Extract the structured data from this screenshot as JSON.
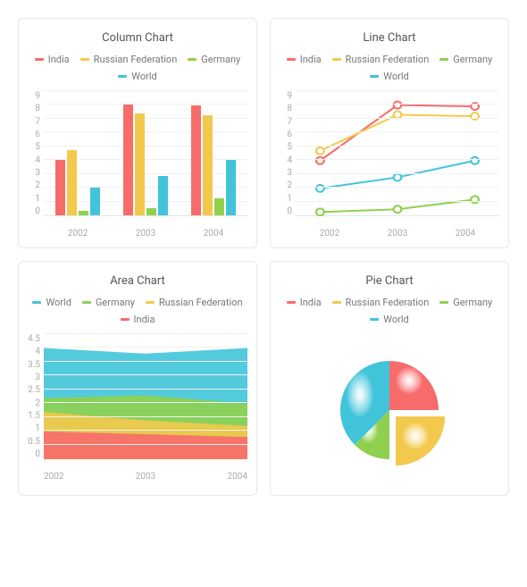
{
  "colors": {
    "India": "#f86b6b",
    "Russian Federation": "#f2c94c",
    "Germany": "#8fd14f",
    "World": "#41c4d9"
  },
  "chart_data": [
    {
      "id": "column",
      "type": "bar",
      "title": "Column Chart",
      "categories": [
        "2002",
        "2003",
        "2004"
      ],
      "series": [
        {
          "name": "India",
          "values": [
            4.0,
            8.0,
            7.9
          ]
        },
        {
          "name": "Russian Federation",
          "values": [
            4.7,
            7.3,
            7.2
          ]
        },
        {
          "name": "Germany",
          "values": [
            0.3,
            0.5,
            1.2
          ]
        },
        {
          "name": "World",
          "values": [
            2.0,
            2.8,
            4.0
          ]
        }
      ],
      "ylim": [
        0,
        9
      ],
      "yticks": [
        0,
        1,
        2,
        3,
        4,
        5,
        6,
        7,
        8,
        9
      ]
    },
    {
      "id": "line",
      "type": "line",
      "title": "Line Chart",
      "categories": [
        "2002",
        "2003",
        "2004"
      ],
      "series": [
        {
          "name": "India",
          "values": [
            4.0,
            8.0,
            7.9
          ]
        },
        {
          "name": "Russian Federation",
          "values": [
            4.7,
            7.3,
            7.2
          ]
        },
        {
          "name": "Germany",
          "values": [
            0.3,
            0.5,
            1.2
          ]
        },
        {
          "name": "World",
          "values": [
            2.0,
            2.8,
            4.0
          ]
        }
      ],
      "ylim": [
        0,
        9
      ],
      "yticks": [
        0,
        1,
        2,
        3,
        4,
        5,
        6,
        7,
        8,
        9
      ]
    },
    {
      "id": "area",
      "type": "area",
      "title": "Area Chart",
      "categories": [
        "2002",
        "2003",
        "2004"
      ],
      "series_order": [
        "World",
        "Germany",
        "Russian Federation",
        "India"
      ],
      "series": [
        {
          "name": "World",
          "values": [
            4.0,
            3.8,
            4.0
          ]
        },
        {
          "name": "Germany",
          "values": [
            2.2,
            2.3,
            2.0
          ]
        },
        {
          "name": "Russian Federation",
          "values": [
            1.7,
            1.4,
            1.2
          ]
        },
        {
          "name": "India",
          "values": [
            1.0,
            0.9,
            0.8
          ]
        }
      ],
      "ylim": [
        0,
        4.5
      ],
      "yticks": [
        0,
        0.5,
        1,
        1.5,
        2,
        2.5,
        3,
        3.5,
        4,
        4.5
      ]
    },
    {
      "id": "pie",
      "type": "pie",
      "title": "Pie Chart",
      "series": [
        {
          "name": "India",
          "value": 25
        },
        {
          "name": "Russian Federation",
          "value": 25
        },
        {
          "name": "Germany",
          "value": 12.5
        },
        {
          "name": "World",
          "value": 37.5
        }
      ]
    }
  ]
}
